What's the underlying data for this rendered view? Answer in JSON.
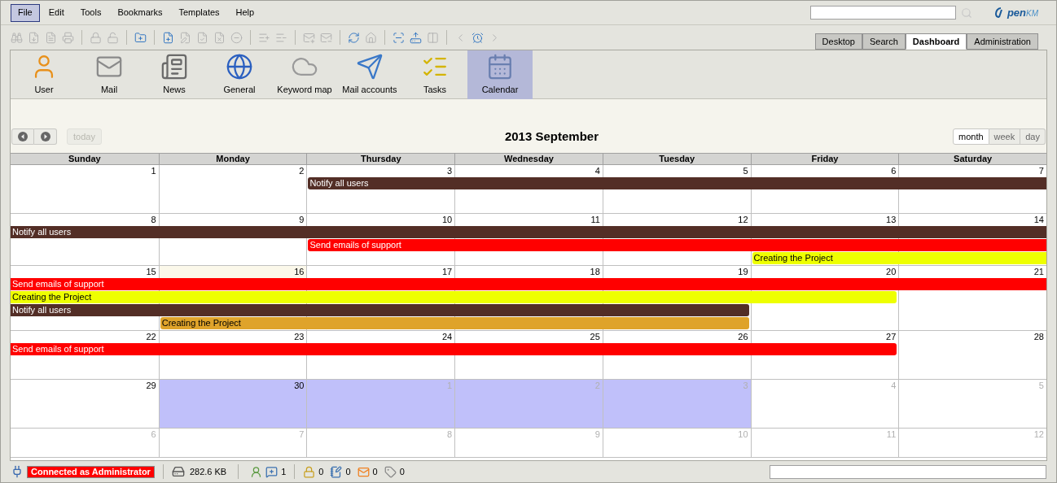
{
  "menu": [
    {
      "label": "File",
      "selected": true
    },
    {
      "label": "Edit",
      "selected": false
    },
    {
      "label": "Tools",
      "selected": false
    },
    {
      "label": "Bookmarks",
      "selected": false
    },
    {
      "label": "Templates",
      "selected": false
    },
    {
      "label": "Help",
      "selected": false
    }
  ],
  "logo": {
    "part_1": "pen",
    "part_2": "KM"
  },
  "toolbar": [
    {
      "kind": "find",
      "enabled": false
    },
    {
      "kind": "download",
      "enabled": false
    },
    {
      "kind": "pdf",
      "enabled": false
    },
    {
      "kind": "print",
      "enabled": false
    },
    {
      "kind": "sep"
    },
    {
      "kind": "lock",
      "enabled": false
    },
    {
      "kind": "unlock",
      "enabled": false
    },
    {
      "kind": "sep"
    },
    {
      "kind": "folder",
      "enabled": true
    },
    {
      "kind": "sep"
    },
    {
      "kind": "document",
      "enabled": true
    },
    {
      "kind": "edit",
      "enabled": false
    },
    {
      "kind": "checkin",
      "enabled": false
    },
    {
      "kind": "cancel",
      "enabled": false
    },
    {
      "kind": "remove",
      "enabled": false
    },
    {
      "kind": "sep"
    },
    {
      "kind": "property",
      "enabled": false
    },
    {
      "kind": "unproperty",
      "enabled": false
    },
    {
      "kind": "sep"
    },
    {
      "kind": "mail",
      "enabled": false
    },
    {
      "kind": "unmail",
      "enabled": false
    },
    {
      "kind": "sep"
    },
    {
      "kind": "refresh",
      "enabled": true
    },
    {
      "kind": "home",
      "enabled": false
    },
    {
      "kind": "sep"
    },
    {
      "kind": "scanner",
      "enabled": true
    },
    {
      "kind": "upload",
      "enabled": true
    },
    {
      "kind": "split",
      "enabled": false
    },
    {
      "kind": "sep"
    },
    {
      "kind": "back",
      "enabled": false
    },
    {
      "kind": "alarm",
      "enabled": true
    },
    {
      "kind": "forward",
      "enabled": false
    }
  ],
  "tabs": [
    {
      "label": "Desktop",
      "selected": false
    },
    {
      "label": "Search",
      "selected": false
    },
    {
      "label": "Dashboard",
      "selected": true
    },
    {
      "label": "Administration",
      "selected": false
    }
  ],
  "modules": [
    {
      "kind": "user",
      "label": "User",
      "selected": false
    },
    {
      "kind": "mail",
      "label": "Mail",
      "selected": false
    },
    {
      "kind": "news",
      "label": "News",
      "selected": false
    },
    {
      "kind": "general",
      "label": "General",
      "selected": false
    },
    {
      "kind": "keyword",
      "label": "Keyword map",
      "selected": false
    },
    {
      "kind": "accounts",
      "label": "Mail accounts",
      "selected": false
    },
    {
      "kind": "tasks",
      "label": "Tasks",
      "selected": false
    },
    {
      "kind": "calendar",
      "label": "Calendar",
      "selected": true
    }
  ],
  "calendar": {
    "title": "2013 September",
    "today_button": "today",
    "views": [
      {
        "label": "month",
        "selected": true
      },
      {
        "label": "week",
        "selected": false
      },
      {
        "label": "day",
        "selected": false
      }
    ],
    "weekdays": [
      "Sunday",
      "Monday",
      "Thursday",
      "Wednesday",
      "Tuesday",
      "Friday",
      "Saturday"
    ],
    "weeks": [
      {
        "days": [
          {
            "number": "1",
            "other_month": false,
            "today": false,
            "selected": false
          },
          {
            "number": "2",
            "other_month": false,
            "today": false,
            "selected": false
          },
          {
            "number": "3",
            "other_month": false,
            "today": false,
            "selected": false
          },
          {
            "number": "4",
            "other_month": false,
            "today": false,
            "selected": false
          },
          {
            "number": "5",
            "other_month": false,
            "today": false,
            "selected": false
          },
          {
            "number": "6",
            "other_month": false,
            "today": false,
            "selected": false
          },
          {
            "number": "7",
            "other_month": false,
            "today": false,
            "selected": false
          }
        ],
        "lanes": [
          [
            {
              "kind": "empty"
            },
            {
              "kind": "empty"
            },
            {
              "kind": "start",
              "title": "Notify all users",
              "color": "#532e26",
              "continued": false,
              "continues": true
            },
            {
              "kind": "more"
            },
            {
              "kind": "more"
            },
            {
              "kind": "more"
            },
            {
              "kind": "more"
            }
          ]
        ]
      },
      {
        "days": [
          {
            "number": "8",
            "other_month": false,
            "today": false,
            "selected": false
          },
          {
            "number": "9",
            "other_month": false,
            "today": false,
            "selected": false
          },
          {
            "number": "10",
            "other_month": false,
            "today": false,
            "selected": false
          },
          {
            "number": "11",
            "other_month": false,
            "today": false,
            "selected": false
          },
          {
            "number": "12",
            "other_month": false,
            "today": false,
            "selected": false
          },
          {
            "number": "13",
            "other_month": false,
            "today": false,
            "selected": false
          },
          {
            "number": "14",
            "other_month": false,
            "today": false,
            "selected": false
          }
        ],
        "lanes": [
          [
            {
              "kind": "start",
              "title": "Notify all users",
              "color": "#532e26",
              "continued": true,
              "continues": true
            },
            {
              "kind": "more"
            },
            {
              "kind": "more"
            },
            {
              "kind": "more"
            },
            {
              "kind": "more"
            },
            {
              "kind": "more"
            },
            {
              "kind": "more"
            }
          ],
          [
            {
              "kind": "empty"
            },
            {
              "kind": "empty"
            },
            {
              "kind": "start",
              "title": "Send emails of support",
              "color": "#ff0000",
              "continued": false,
              "continues": true
            },
            {
              "kind": "more"
            },
            {
              "kind": "more"
            },
            {
              "kind": "more"
            },
            {
              "kind": "more"
            }
          ],
          [
            {
              "kind": "empty"
            },
            {
              "kind": "empty"
            },
            {
              "kind": "empty"
            },
            {
              "kind": "empty"
            },
            {
              "kind": "empty"
            },
            {
              "kind": "start",
              "title": "Creating the Project",
              "color": "#eeff00",
              "continued": false,
              "continues": true
            },
            {
              "kind": "more"
            }
          ]
        ]
      },
      {
        "days": [
          {
            "number": "15",
            "other_month": false,
            "today": false,
            "selected": false
          },
          {
            "number": "16",
            "other_month": false,
            "today": true,
            "selected": false
          },
          {
            "number": "17",
            "other_month": false,
            "today": false,
            "selected": false
          },
          {
            "number": "18",
            "other_month": false,
            "today": false,
            "selected": false
          },
          {
            "number": "19",
            "other_month": false,
            "today": false,
            "selected": false
          },
          {
            "number": "20",
            "other_month": false,
            "today": false,
            "selected": false
          },
          {
            "number": "21",
            "other_month": false,
            "today": false,
            "selected": false
          }
        ],
        "lanes": [
          [
            {
              "kind": "start",
              "title": "Send emails of support",
              "color": "#ff0000",
              "continued": true,
              "continues": true
            },
            {
              "kind": "more"
            },
            {
              "kind": "more"
            },
            {
              "kind": "more"
            },
            {
              "kind": "more"
            },
            {
              "kind": "more"
            },
            {
              "kind": "more"
            }
          ],
          [
            {
              "kind": "start",
              "title": "Creating the Project",
              "color": "#eeff00",
              "continued": true,
              "continues": false
            },
            {
              "kind": "more"
            },
            {
              "kind": "more"
            },
            {
              "kind": "more"
            },
            {
              "kind": "more"
            },
            {
              "kind": "more"
            },
            {
              "kind": "empty"
            }
          ],
          [
            {
              "kind": "start",
              "title": "Notify all users",
              "color": "#532e26",
              "continued": true,
              "continues": false
            },
            {
              "kind": "more"
            },
            {
              "kind": "more"
            },
            {
              "kind": "more"
            },
            {
              "kind": "more"
            },
            {
              "kind": "empty"
            },
            {
              "kind": "empty"
            }
          ],
          [
            {
              "kind": "empty"
            },
            {
              "kind": "start",
              "title": "Creating the Project",
              "color": "#dfa32a",
              "continued": false,
              "continues": false
            },
            {
              "kind": "more"
            },
            {
              "kind": "more"
            },
            {
              "kind": "more"
            },
            {
              "kind": "empty"
            },
            {
              "kind": "empty"
            }
          ]
        ]
      },
      {
        "days": [
          {
            "number": "22",
            "other_month": false,
            "today": false,
            "selected": false
          },
          {
            "number": "23",
            "other_month": false,
            "today": false,
            "selected": false
          },
          {
            "number": "24",
            "other_month": false,
            "today": false,
            "selected": false
          },
          {
            "number": "25",
            "other_month": false,
            "today": false,
            "selected": false
          },
          {
            "number": "26",
            "other_month": false,
            "today": false,
            "selected": false
          },
          {
            "number": "27",
            "other_month": false,
            "today": false,
            "selected": false
          },
          {
            "number": "28",
            "other_month": false,
            "today": false,
            "selected": false
          }
        ],
        "lanes": [
          [
            {
              "kind": "start",
              "title": "Send emails of support",
              "color": "#ff0000",
              "continued": true,
              "continues": false
            },
            {
              "kind": "more"
            },
            {
              "kind": "more"
            },
            {
              "kind": "more"
            },
            {
              "kind": "more"
            },
            {
              "kind": "more"
            },
            {
              "kind": "empty"
            }
          ]
        ]
      },
      {
        "days": [
          {
            "number": "29",
            "other_month": false,
            "today": false,
            "selected": false
          },
          {
            "number": "30",
            "other_month": false,
            "today": false,
            "selected": true
          },
          {
            "number": "1",
            "other_month": true,
            "today": false,
            "selected": true
          },
          {
            "number": "2",
            "other_month": true,
            "today": false,
            "selected": true
          },
          {
            "number": "3",
            "other_month": true,
            "today": false,
            "selected": true
          },
          {
            "number": "4",
            "other_month": true,
            "today": false,
            "selected": false
          },
          {
            "number": "5",
            "other_month": true,
            "today": false,
            "selected": false
          }
        ]
      },
      {
        "days": [
          {
            "number": "6",
            "other_month": true,
            "today": false,
            "selected": false
          },
          {
            "number": "7",
            "other_month": true,
            "today": false,
            "selected": false
          },
          {
            "number": "8",
            "other_month": true,
            "today": false,
            "selected": false
          },
          {
            "number": "9",
            "other_month": true,
            "today": false,
            "selected": false
          },
          {
            "number": "10",
            "other_month": true,
            "today": false,
            "selected": false
          },
          {
            "number": "11",
            "other_month": true,
            "today": false,
            "selected": false
          },
          {
            "number": "12",
            "other_month": true,
            "today": false,
            "selected": false
          }
        ]
      }
    ]
  },
  "status_bar": {
    "connection": "Connected as Administrator",
    "size": "282.6 KB",
    "messages": "1",
    "locked": "0",
    "checked_out": "0",
    "mail": "0",
    "subscribed": "0"
  }
}
